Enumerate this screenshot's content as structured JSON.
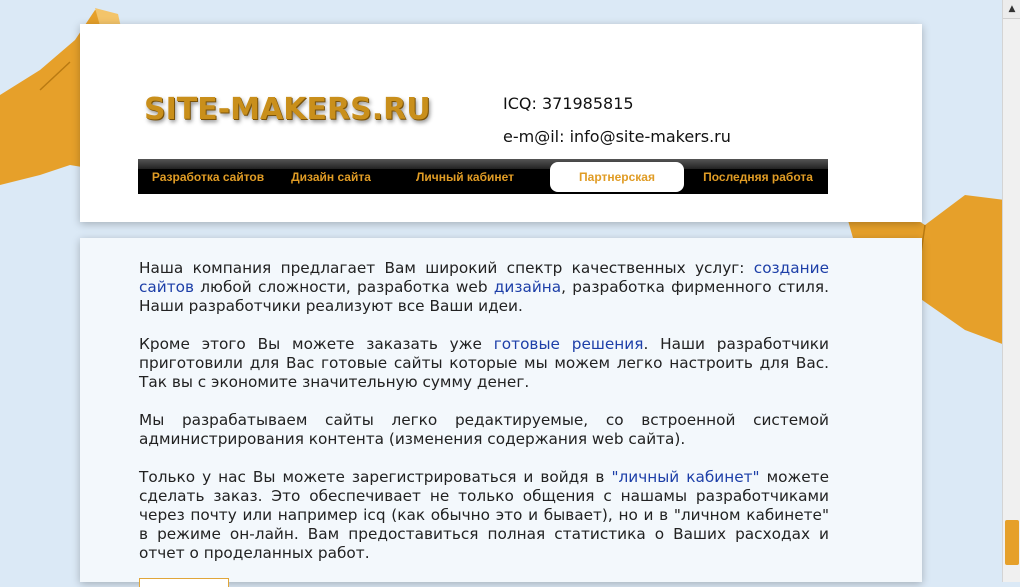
{
  "header": {
    "logo": "SITE-MAKERS.RU",
    "icq": "ICQ: 371985815",
    "email": "e-m@il: info@site-makers.ru"
  },
  "nav": {
    "items": [
      {
        "label": "Разработка сайтов"
      },
      {
        "label": "Дизайн сайта"
      },
      {
        "label": "Личный кабинет"
      },
      {
        "label": "Партнерская"
      },
      {
        "label": "Последняя работа"
      }
    ],
    "active_index": 3
  },
  "content": {
    "p1": {
      "t1": " Наша компания предлагает Вам широкий спектр качественных услуг: ",
      "link1": "создание сайтов",
      "t2": " любой сложности, разработка web ",
      "link2": "дизайна",
      "t3": ", разработка фирменного стиля. Наши разработчики реализуют все Ваши идеи."
    },
    "p2": {
      "t1": "Кроме этого Вы можете заказать уже ",
      "link1": "готовые решения",
      "t2": ". Наши разработчики приготовили для Вас готовые сайты которые мы можем легко настроить для Вас. Так вы с экономите значительную сумму денег."
    },
    "p3": "Мы разрабатываем сайты легко редактируемые, со встроенной системой администрирования контента (изменения содержания web сайта).",
    "p4": {
      "t1": "Только у нас Вы можете зарегистрироваться и войдя в ",
      "link1": "\"личный кабинет\"",
      "t2": " можете сделать заказ. Это обеспечивает не только общения с нашамы разработчиками через почту или например icq (как обычно это и бывает), но и в \"личном кабинете\" в режиме он-лайн. Вам предоставиться полная статистика о Ваших расходах и отчет о проделанных работ."
    }
  },
  "colors": {
    "accent": "#e09c25",
    "background": "#dbe9f6",
    "link": "#1d3fa8"
  }
}
